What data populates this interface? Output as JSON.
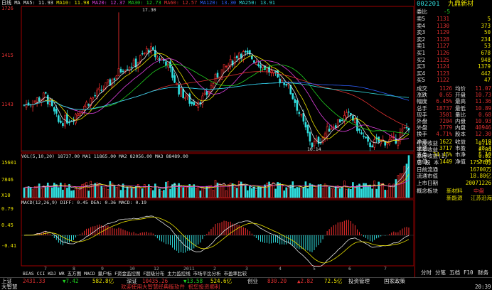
{
  "chart": {
    "period_label": "日线",
    "ma_legend": [
      {
        "text": "MA  MA5: 11.93",
        "color": "#e0e0e0"
      },
      {
        "text": "MA10: 11.98",
        "color": "#e8e000"
      },
      {
        "text": "MA20: 12.37",
        "color": "#e040e0"
      },
      {
        "text": "MA30: 12.73",
        "color": "#20d020"
      },
      {
        "text": "MA60: 12.57",
        "color": "#e03030"
      },
      {
        "text": "MA120: 13.30",
        "color": "#3060ff"
      },
      {
        "text": "MA250: 13.91",
        "color": "#30d8d8"
      }
    ],
    "price_ticks": [
      "1726",
      "1415",
      "1143"
    ],
    "high_marker": "17.30",
    "low_marker": "10.14",
    "vol_legend": "VOL(5,10,20)  18737.00  MA1 11865.00  MA2 82056.00  MA3 88489.00",
    "vol_ticks": [
      "15601",
      "7846",
      "X10"
    ],
    "macd_legend": "MACD(12,26,9)  DIFF: 0.45  DEA: 0.36  MACD: 0.19",
    "macd_ticks": [
      "0.79",
      "0.45",
      "-0.41"
    ],
    "month_ticks": [
      "7",
      "8",
      "9",
      "10",
      "12",
      "2011",
      "2",
      "3",
      "4",
      "5",
      "6",
      "7"
    ],
    "indicator_tabs": [
      "BIAS",
      "CCI",
      "KDJ",
      "WR",
      "五方图",
      "MACD",
      "量户标",
      "F资金监控图",
      "F超级分布",
      "主力监控线",
      "市场平比分析",
      "市盈率比较"
    ]
  },
  "quote": {
    "code": "002201",
    "name": "九鼎新材",
    "weibi_label": "委比",
    "weibi_value": "-5",
    "sell": [
      {
        "label": "卖5",
        "price": "1131",
        "vol": "5"
      },
      {
        "label": "卖4",
        "price": "1130",
        "vol": "373"
      },
      {
        "label": "卖3",
        "price": "1129",
        "vol": "50"
      },
      {
        "label": "卖2",
        "price": "1128",
        "vol": "234"
      },
      {
        "label": "卖1",
        "price": "1127",
        "vol": "53"
      }
    ],
    "buy": [
      {
        "label": "买1",
        "price": "1126",
        "vol": "678"
      },
      {
        "label": "买2",
        "price": "1125",
        "vol": "948"
      },
      {
        "label": "买3",
        "price": "1124",
        "vol": "1379"
      },
      {
        "label": "买4",
        "price": "1123",
        "vol": "442"
      },
      {
        "label": "买5",
        "price": "1122",
        "vol": "47"
      }
    ],
    "stats": [
      {
        "l1": "成交",
        "v1": "1126",
        "l2": "均价",
        "v2": "11.07"
      },
      {
        "l1": "涨跌",
        "v1": "0.65",
        "l2": "开盘",
        "v2": "10.73"
      },
      {
        "l1": "幅度",
        "v1": "6.45%",
        "l2": "最高",
        "v2": "11.36"
      },
      {
        "l1": "总手",
        "v1": "18737",
        "l2": "最低",
        "v2": "10.89"
      },
      {
        "l1": "现手",
        "v1": "3501",
        "l2": "量比",
        "v2": "0.68"
      },
      {
        "l1": "外盘",
        "v1": "7204",
        "l2": "内盘",
        "v2": "10.93"
      },
      {
        "l1": "外盘",
        "v1": "3779",
        "l2": "内盘",
        "v2": "40946"
      },
      {
        "l1": "换手",
        "v1": "4.71%",
        "l2": "股本",
        "v2": "12.30"
      }
    ],
    "fund": [
      {
        "l1": "净资",
        "v1": "1622",
        "l2": "收益",
        "v2": "1.918"
      },
      {
        "l1": "流通",
        "v1": "3717",
        "l2": "市盈",
        "v2": "28.4"
      },
      {
        "l1": "五类",
        "v1": "34.45%",
        "l2": "市净",
        "v2": "5.10"
      },
      {
        "l1": "市值",
        "v1": "1449",
        "l2": "净值",
        "v2": "2.91"
      }
    ],
    "returns": [
      {
        "label": "年度收益",
        "value": "0.11"
      },
      {
        "label": "半年收益",
        "value": "0.04"
      },
      {
        "label": "季度收益(1)",
        "value": "0.02"
      }
    ],
    "capital": [
      {
        "label": "总 股 本",
        "value": "17576万"
      },
      {
        "label": "日前流通",
        "value": "16700万"
      },
      {
        "label": "流通市值",
        "value": "18.80亿"
      },
      {
        "label": "上市日期",
        "value": "20071226"
      }
    ],
    "sector_label": "概念板块",
    "sectors": [
      "新材料",
      "中盘"
    ],
    "sector_extra": [
      "新能源",
      "江苏沿海"
    ],
    "tabs": [
      "分时",
      "分笔",
      "五档",
      "F10",
      "财务"
    ]
  },
  "statusbar": {
    "row1": [
      {
        "text": "上证",
        "color": "#e0e0e0"
      },
      {
        "text": "2431.33",
        "color": "#e03030"
      },
      {
        "text": "▼7.42",
        "color": "#20d020"
      },
      {
        "text": "582.8亿",
        "color": "#e8e000"
      },
      {
        "text": "深证",
        "color": "#e0e0e0"
      },
      {
        "text": "10435.26",
        "color": "#e03030"
      },
      {
        "text": "▼13.58",
        "color": "#20d020"
      },
      {
        "text": "524.6亿",
        "color": "#e8e000"
      },
      {
        "text": "创业",
        "color": "#e0e0e0"
      },
      {
        "text": "830.20",
        "color": "#e03030"
      },
      {
        "text": "▲2.82",
        "color": "#e03030"
      },
      {
        "text": "72.5亿",
        "color": "#e8e000"
      },
      {
        "text": "投资管理",
        "color": "#e0e0e0"
      },
      {
        "text": "国家政策",
        "color": "#e0e0e0"
      }
    ],
    "row2": [
      {
        "text": "大智慧",
        "color": "#e0e0e0"
      },
      {
        "text": "欢迎使用大智慧经典版软件 祝您投资顺利",
        "color": "#e03030"
      },
      {
        "text": "20:39",
        "color": "#e0e0e0"
      }
    ]
  }
}
